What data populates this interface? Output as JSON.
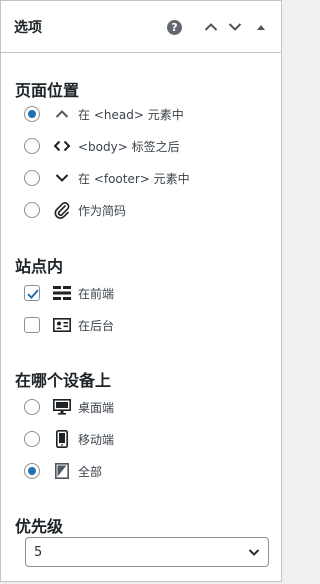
{
  "header": {
    "title": "选项",
    "help_glyph": "?"
  },
  "position": {
    "title": "页面位置",
    "options": [
      {
        "label": "在 <head> 元素中",
        "icon": "chevron-up-icon",
        "selected": true
      },
      {
        "label": "<body> 标签之后",
        "icon": "code-icon",
        "selected": false
      },
      {
        "label": "在 <footer> 元素中",
        "icon": "chevron-down-icon",
        "selected": false
      },
      {
        "label": "作为简码",
        "icon": "paperclip-icon",
        "selected": false
      }
    ]
  },
  "site": {
    "title": "站点内",
    "options": [
      {
        "label": "在前端",
        "icon": "frontend-icon",
        "checked": true
      },
      {
        "label": "在后台",
        "icon": "admin-icon",
        "checked": false
      }
    ]
  },
  "device": {
    "title": "在哪个设备上",
    "options": [
      {
        "label": "桌面端",
        "icon": "desktop-icon",
        "selected": false
      },
      {
        "label": "移动端",
        "icon": "mobile-icon",
        "selected": false
      },
      {
        "label": "全部",
        "icon": "all-devices-icon",
        "selected": true
      }
    ]
  },
  "priority": {
    "title": "优先级",
    "value": "5"
  },
  "colors": {
    "accent": "#2271b1",
    "text": "#1d2327",
    "border": "#8c8f94"
  }
}
